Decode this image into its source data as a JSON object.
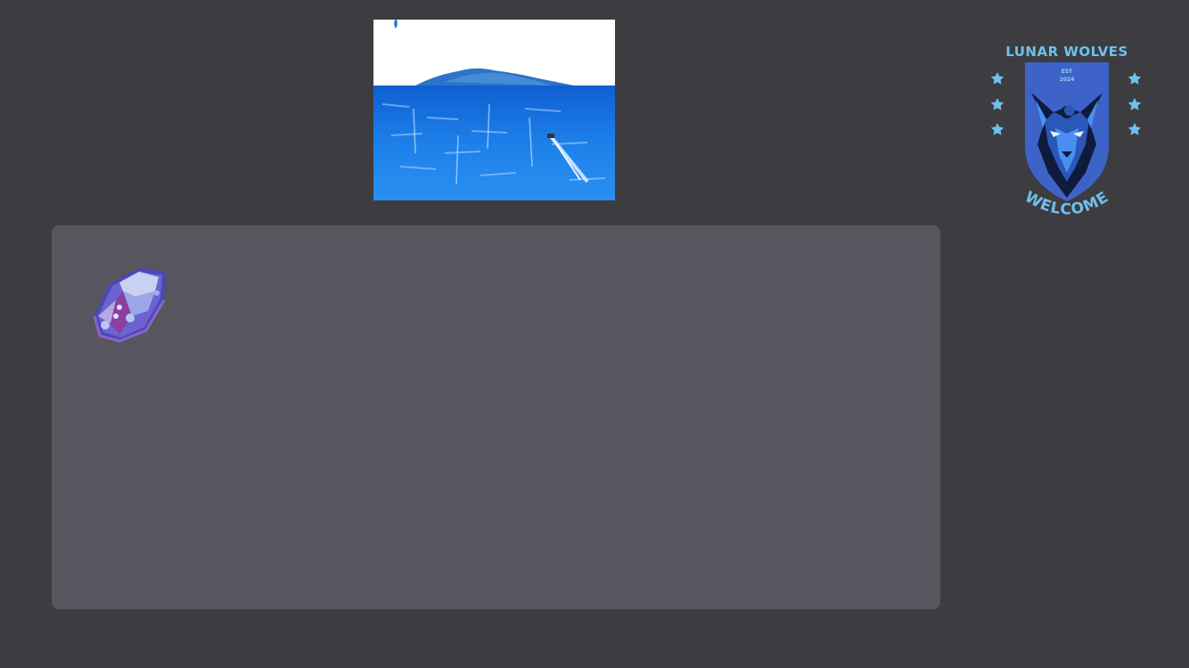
{
  "top_image": {
    "description_icon": "ocean-horizon-image"
  },
  "emblem": {
    "title": "LUNAR WOLVES",
    "established": "EST",
    "year": "2024",
    "welcome": "WELCOME",
    "icon": "wolf-emblem-icon",
    "star_icon": "star-icon",
    "colors": {
      "text": "#6fc0ec",
      "shield": "#3e63c8",
      "wolf_dark": "#0f1b3d",
      "wolf_light": "#4a8ff0"
    }
  },
  "panel": {
    "icon": "gem-icon",
    "background": "#57565e"
  },
  "colors": {
    "page_background": "#3d3c41",
    "ocean": "#1e7ae0",
    "sky": "#ffffff"
  }
}
